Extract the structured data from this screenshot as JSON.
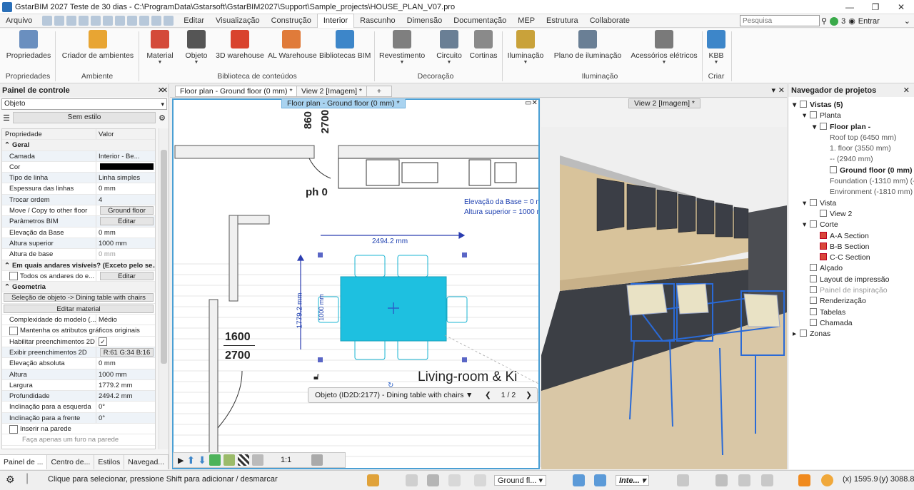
{
  "window": {
    "title": "GstarBIM  2027 Teste de 30 dias - C:\\ProgramData\\Gstarsoft\\GstarBIM2027\\Support\\Sample_projects\\HOUSE_PLAN_V07.pro",
    "controls": [
      "—",
      "❐",
      "✕"
    ]
  },
  "menu": {
    "file": "Arquivo",
    "tabs": [
      "Editar",
      "Visualização",
      "Construção",
      "Interior",
      "Rascunho",
      "Dimensão",
      "Documentação",
      "MEP",
      "Estrutura",
      "Collaborate"
    ],
    "active": "Interior",
    "search_placeholder": "Pesquisa",
    "notif_count": "3",
    "login": "Entrar"
  },
  "ribbon": {
    "buttons": [
      {
        "label": "Propriedades",
        "icon": "properties-icon",
        "color": "#6a8fbf"
      },
      {
        "label": "Criador de ambientes",
        "icon": "room-creator-icon",
        "color": "#e8a533"
      },
      {
        "label": "Material",
        "icon": "material-palette-icon",
        "color": "#d44a3a"
      },
      {
        "label": "Objeto",
        "icon": "chair-icon",
        "color": "#555555"
      },
      {
        "label": "3D warehouse",
        "icon": "warehouse-icon",
        "color": "#d9432e"
      },
      {
        "label": "AL Warehouse",
        "icon": "al-warehouse-icon",
        "color": "#e07b3a"
      },
      {
        "label": "Bibliotecas BIM",
        "icon": "download-icon",
        "color": "#3d86c9"
      },
      {
        "label": "Revestimento",
        "icon": "tiles-icon",
        "color": "#7f7f7f"
      },
      {
        "label": "Circuito",
        "icon": "circuit-icon",
        "color": "#6a7f95"
      },
      {
        "label": "Cortinas",
        "icon": "curtain-icon",
        "color": "#8a8a8a"
      },
      {
        "label": "Iluminação",
        "icon": "lamp-icon",
        "color": "#c9a23a"
      },
      {
        "label": "Plano de iluminação",
        "icon": "lighting-plan-icon",
        "color": "#6a7f95"
      },
      {
        "label": "Acessórios elétricos",
        "icon": "socket-icon",
        "color": "#7a7a7a"
      },
      {
        "label": "KBB",
        "icon": "kbb-icon",
        "color": "#3d86c9"
      }
    ],
    "groups": [
      "Propriedades",
      "Ambiente",
      "Biblioteca de conteúdos",
      "Decoração",
      "Iluminação",
      "Criar"
    ]
  },
  "control_panel": {
    "title": "Painel de controle",
    "selector": "Objeto",
    "style_button": "Sem estilo",
    "header": {
      "prop": "Propriedade",
      "value": "Valor"
    },
    "rows": [
      {
        "type": "sec",
        "k": "Geral"
      },
      {
        "k": "Camada",
        "v": "Interior - Be...",
        "dd": true
      },
      {
        "k": "Cor",
        "v": "",
        "swatch": "#000000"
      },
      {
        "k": "Tipo de linha",
        "v": "Linha simples",
        "dd": true
      },
      {
        "k": "Espessura das linhas",
        "v": "0 mm",
        "dd": true
      },
      {
        "k": "Trocar ordem",
        "v": "4",
        "dd": true
      },
      {
        "k": "Move / Copy to other floor",
        "btn": "Ground floor"
      },
      {
        "k": "Parâmetros BIM",
        "btn": "Editar"
      },
      {
        "k": "Elevação da Base",
        "v": "0 mm",
        "dd": true
      },
      {
        "k": "Altura superior",
        "v": "1000 mm"
      },
      {
        "k": "Altura de base",
        "v": "0 mm",
        "disabled": true
      },
      {
        "type": "sec",
        "k": "Em quais andares visíveis? (Exceto pelo se..."
      },
      {
        "k": "Todos os andares do e...",
        "btn": "Editar",
        "cb": true
      },
      {
        "type": "sec",
        "k": "Geometria"
      },
      {
        "type": "full",
        "btn": "Seleção de objeto -> Dining table with chairs"
      },
      {
        "type": "full",
        "btn": "Editar material"
      },
      {
        "k": "Complexidade do modelo (...",
        "v": "Médio"
      },
      {
        "type": "cbfull",
        "k": "Mantenha os atributos gráficos originais"
      },
      {
        "k": "Habilitar preenchimentos 2D",
        "v": "✓",
        "check": true
      },
      {
        "k": "Exibir preenchimentos 2D",
        "btn": "R:61 G:34 B:16"
      },
      {
        "k": "Elevação absoluta",
        "v": "0 mm"
      },
      {
        "k": "Altura",
        "v": "1000 mm"
      },
      {
        "k": "Largura",
        "v": "1779.2 mm"
      },
      {
        "k": "Profundidade",
        "v": "2494.2 mm"
      },
      {
        "k": "Inclinação para a esquerda",
        "v": "0°",
        "dd": true
      },
      {
        "k": "Inclinação para a frente",
        "v": "0°",
        "dd": true
      },
      {
        "type": "cbfull",
        "k": "Inserir na parede"
      },
      {
        "type": "note",
        "k": "Faça apenas um furo na parede"
      }
    ],
    "tabs": [
      "Painel de ...",
      "Centro de...",
      "Estilos",
      "Navegad..."
    ]
  },
  "doc_tabs": [
    "Floor plan - Ground floor (0 mm) *",
    "View 2 [Imagem] *",
    "+"
  ],
  "floor_plan": {
    "caption": "Floor plan - Ground floor (0 mm) *",
    "dim_860": "860",
    "dim_2700": "2700",
    "ph": "ph 0",
    "elev_base": "Elevação da Base = 0 mm",
    "elev_top": "Altura superior = 1000 m",
    "width_dim": "2494.2 mm",
    "height_dim": "1779.2 mm",
    "small_dim": "1000 mm",
    "door_1600": "1600",
    "door_2700": "2700",
    "room_label": "Living-room & Ki",
    "table_color": "#1ec0e0",
    "scale": "1:1"
  },
  "object_bar": {
    "label": "Objeto (ID2D:2177) - Dining table with chairs",
    "page": "1 / 2"
  },
  "view2": {
    "caption": "View 2 [Imagem] *"
  },
  "navigator": {
    "title": "Navegador de projetos",
    "items": [
      {
        "label": "Vistas (5)",
        "lvl": 0,
        "b": true,
        "exp": "▾"
      },
      {
        "label": "Planta",
        "lvl": 1,
        "exp": "▾"
      },
      {
        "label": "Floor plan -",
        "lvl": 2,
        "b": true,
        "exp": "▾"
      },
      {
        "label": "Roof top (6450 mm)",
        "lvl": 3,
        "grey": true
      },
      {
        "label": "1. floor (3550 mm)",
        "lvl": 3,
        "grey": true
      },
      {
        "label": "-- (2940 mm)",
        "lvl": 3,
        "grey": true
      },
      {
        "label": "Ground floor (0 mm)",
        "lvl": 3,
        "b": true
      },
      {
        "label": "Foundation (-1310 mm) (-1",
        "lvl": 3,
        "grey": true
      },
      {
        "label": "Environment (-1810 mm) (-1",
        "lvl": 3,
        "grey": true
      },
      {
        "label": "Vista",
        "lvl": 1,
        "exp": "▾"
      },
      {
        "label": "View 2",
        "lvl": 2
      },
      {
        "label": "Corte",
        "lvl": 1,
        "exp": "▾"
      },
      {
        "label": "A-A Section",
        "lvl": 2,
        "red": true
      },
      {
        "label": "B-B Section",
        "lvl": 2,
        "red": true
      },
      {
        "label": "C-C Section",
        "lvl": 2,
        "red": true
      },
      {
        "label": "Alçado",
        "lvl": 1
      },
      {
        "label": "Layout de impressão",
        "lvl": 1
      },
      {
        "label": "Painel de inspiração",
        "lvl": 1,
        "dis": true
      },
      {
        "label": "Renderização",
        "lvl": 1
      },
      {
        "label": "Tabelas",
        "lvl": 1
      },
      {
        "label": "Chamada",
        "lvl": 1
      },
      {
        "label": "Zonas",
        "lvl": 0,
        "exp": "▸"
      }
    ]
  },
  "status": {
    "hint": "Clique para selecionar, pressione Shift para adicionar / desmarcar",
    "floor": "Ground fl...",
    "layer": "Inte...",
    "x": "(x) 1595.9",
    "y": "(y) 3088.8"
  }
}
